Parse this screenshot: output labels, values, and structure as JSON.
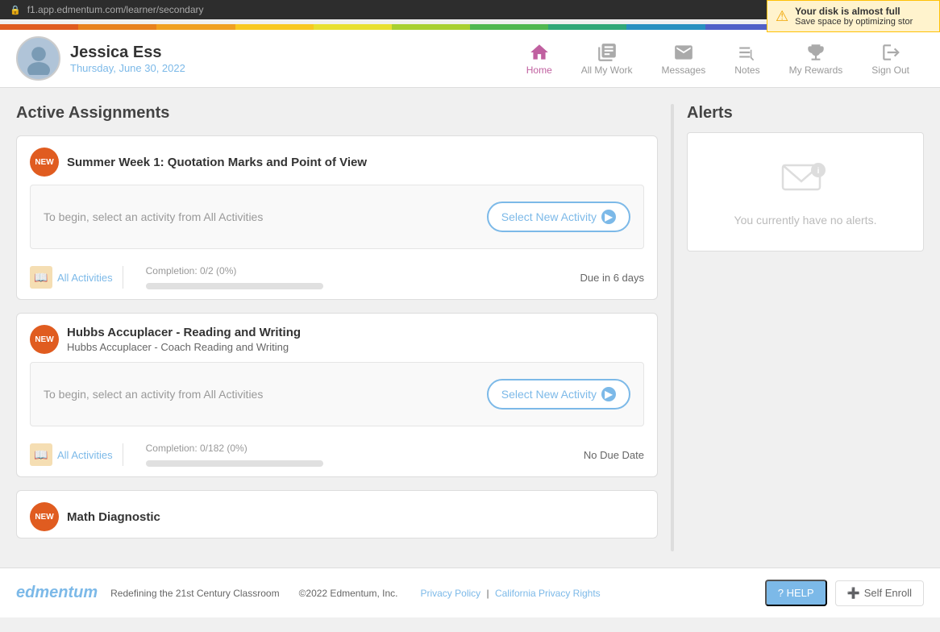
{
  "notif": {
    "line1": "Your disk is almost full",
    "line2": "Save space by optimizing stor"
  },
  "addressBar": {
    "url": "f1.app.edmentum.com/learner/secondary"
  },
  "header": {
    "user_name": "Jessica Ess",
    "user_date": "Thursday, June 30, 2022",
    "nav": [
      {
        "id": "home",
        "label": "Home",
        "active": true
      },
      {
        "id": "all-my-work",
        "label": "All My Work",
        "active": false
      },
      {
        "id": "messages",
        "label": "Messages",
        "active": false
      },
      {
        "id": "notes",
        "label": "Notes",
        "active": false
      },
      {
        "id": "my-rewards",
        "label": "My Rewards",
        "active": false
      },
      {
        "id": "sign-out",
        "label": "Sign Out",
        "active": false
      }
    ]
  },
  "colorStripe": [
    "#e05c20",
    "#e8821e",
    "#f0a020",
    "#f8c820",
    "#e8e030",
    "#a8d030",
    "#50b850",
    "#30a878",
    "#2890c0",
    "#5060c8",
    "#8050c8",
    "#c050a0"
  ],
  "activeAssignments": {
    "title": "Active Assignments",
    "assignments": [
      {
        "id": "assignment-1",
        "badge": "NEW",
        "title": "Summer Week 1: Quotation Marks and Point of View",
        "subtitle": "",
        "hint": "To begin, select an activity from All Activities",
        "select_btn": "Select New Activity",
        "all_activities": "All Activities",
        "completion": "Completion: 0/2 (0%)",
        "progress": 0,
        "due": "Due in 6 days"
      },
      {
        "id": "assignment-2",
        "badge": "NEW",
        "title": "Hubbs Accuplacer - Reading and Writing",
        "subtitle": "Hubbs Accuplacer - Coach Reading and Writing",
        "hint": "To begin, select an activity from All Activities",
        "select_btn": "Select New Activity",
        "all_activities": "All Activities",
        "completion": "Completion: 0/182 (0%)",
        "progress": 0,
        "due": "No Due Date"
      },
      {
        "id": "assignment-3",
        "badge": "NEW",
        "title": "Math Diagnostic",
        "subtitle": "",
        "hint": "",
        "select_btn": "",
        "all_activities": "",
        "completion": "",
        "progress": 0,
        "due": ""
      }
    ]
  },
  "alerts": {
    "title": "Alerts",
    "empty_text": "You currently have no alerts."
  },
  "footer": {
    "logo": "edmentum",
    "tagline": "Redefining the 21st Century Classroom",
    "copyright": "©2022 Edmentum, Inc.",
    "links": [
      "Privacy Policy",
      "California Privacy Rights"
    ],
    "help_btn": "? HELP",
    "self_enroll_btn": "Self Enroll"
  }
}
